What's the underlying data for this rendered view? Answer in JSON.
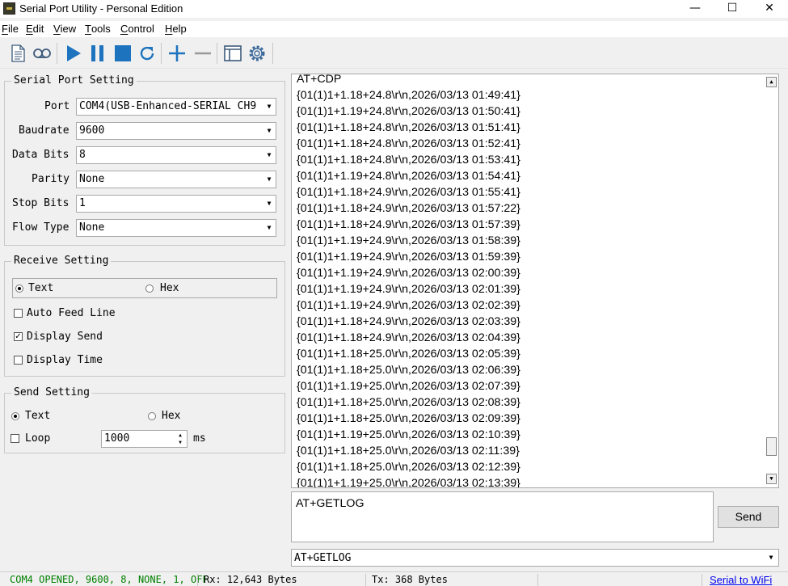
{
  "window": {
    "title": "Serial Port Utility - Personal Edition",
    "minimize": "—",
    "maximize": "☐",
    "close": "✕"
  },
  "menu": {
    "file": {
      "key": "F",
      "rest": "ile"
    },
    "edit": {
      "key": "E",
      "rest": "dit"
    },
    "view": {
      "key": "V",
      "rest": "iew"
    },
    "tools": {
      "key": "T",
      "rest": "ools"
    },
    "control": {
      "key": "C",
      "rest": "ontrol"
    },
    "help": {
      "key": "H",
      "rest": "elp"
    }
  },
  "serial_port_setting": {
    "title": "Serial Port Setting",
    "port_label": "Port",
    "port_value": "COM4(USB-Enhanced-SERIAL CH9",
    "baudrate_label": "Baudrate",
    "baudrate_value": "9600",
    "databits_label": "Data Bits",
    "databits_value": "8",
    "parity_label": "Parity",
    "parity_value": "None",
    "stopbits_label": "Stop Bits",
    "stopbits_value": "1",
    "flowtype_label": "Flow Type",
    "flowtype_value": "None"
  },
  "receive_setting": {
    "title": "Receive Setting",
    "text_label": "Text",
    "hex_label": "Hex",
    "mode": "text",
    "auto_feed_label": "Auto Feed Line",
    "auto_feed": false,
    "display_send_label": "Display Send",
    "display_send": true,
    "display_time_label": "Display Time",
    "display_time": false
  },
  "send_setting": {
    "title": "Send Setting",
    "text_label": "Text",
    "hex_label": "Hex",
    "mode": "text",
    "loop_label": "Loop",
    "loop": false,
    "interval_value": "1000",
    "interval_unit": "ms"
  },
  "receive_lines": [
    "AT+CDP",
    "{01(1)1+1.18+24.8\\r\\n,2026/03/13 01:49:41}",
    "{01(1)1+1.19+24.8\\r\\n,2026/03/13 01:50:41}",
    "{01(1)1+1.18+24.8\\r\\n,2026/03/13 01:51:41}",
    "{01(1)1+1.18+24.8\\r\\n,2026/03/13 01:52:41}",
    "{01(1)1+1.18+24.8\\r\\n,2026/03/13 01:53:41}",
    "{01(1)1+1.19+24.8\\r\\n,2026/03/13 01:54:41}",
    "{01(1)1+1.18+24.9\\r\\n,2026/03/13 01:55:41}",
    "{01(1)1+1.18+24.9\\r\\n,2026/03/13 01:57:22}",
    "{01(1)1+1.18+24.9\\r\\n,2026/03/13 01:57:39}",
    "{01(1)1+1.19+24.9\\r\\n,2026/03/13 01:58:39}",
    "{01(1)1+1.19+24.9\\r\\n,2026/03/13 01:59:39}",
    "{01(1)1+1.19+24.9\\r\\n,2026/03/13 02:00:39}",
    "{01(1)1+1.19+24.9\\r\\n,2026/03/13 02:01:39}",
    "{01(1)1+1.19+24.9\\r\\n,2026/03/13 02:02:39}",
    "{01(1)1+1.18+24.9\\r\\n,2026/03/13 02:03:39}",
    "{01(1)1+1.18+24.9\\r\\n,2026/03/13 02:04:39}",
    "{01(1)1+1.18+25.0\\r\\n,2026/03/13 02:05:39}",
    "{01(1)1+1.18+25.0\\r\\n,2026/03/13 02:06:39}",
    "{01(1)1+1.19+25.0\\r\\n,2026/03/13 02:07:39}",
    "{01(1)1+1.18+25.0\\r\\n,2026/03/13 02:08:39}",
    "{01(1)1+1.18+25.0\\r\\n,2026/03/13 02:09:39}",
    "{01(1)1+1.19+25.0\\r\\n,2026/03/13 02:10:39}",
    "{01(1)1+1.18+25.0\\r\\n,2026/03/13 02:11:39}",
    "{01(1)1+1.18+25.0\\r\\n,2026/03/13 02:12:39}",
    "{01(1)1+1.19+25.0\\r\\n,2026/03/13 02:13:39}"
  ],
  "send": {
    "text": "AT+GETLOG",
    "button": "Send",
    "history_value": "AT+GETLOG"
  },
  "status": {
    "connection": "COM4 OPENED, 9600, 8, NONE, 1, OFF",
    "connection_color": "#008000",
    "rx": "Rx: 12,643 Bytes",
    "tx": "Tx: 368 Bytes",
    "link": "Serial to WiFi"
  },
  "toolbar_icons": [
    "new-document-icon",
    "loop-icon",
    "play-icon",
    "pause-icon",
    "stop-icon",
    "refresh-icon",
    "add-icon",
    "remove-icon",
    "window-icon",
    "settings-icon"
  ],
  "accent_color": "#1e73be"
}
